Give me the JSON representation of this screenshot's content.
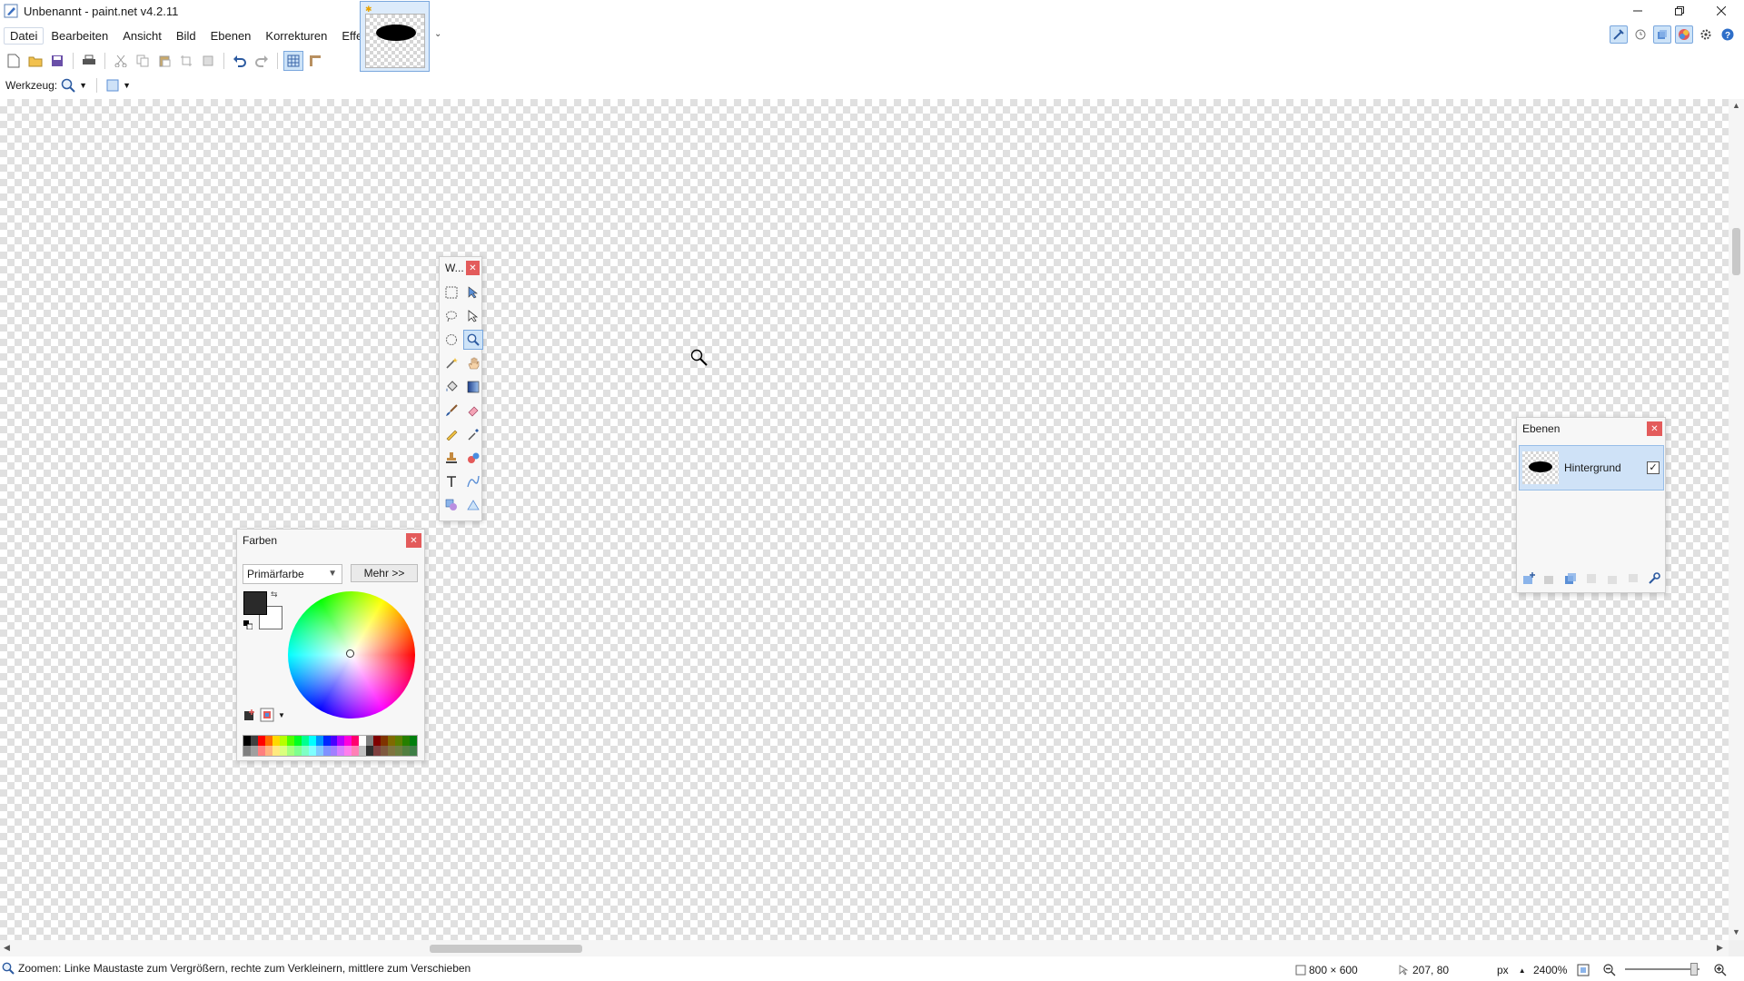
{
  "window": {
    "title": "Unbenannt - paint.net v4.2.11"
  },
  "menu": [
    "Datei",
    "Bearbeiten",
    "Ansicht",
    "Bild",
    "Ebenen",
    "Korrekturen",
    "Effekte"
  ],
  "toolrow": {
    "label": "Werkzeug:"
  },
  "tools_window": {
    "title": "W..."
  },
  "colors_window": {
    "title": "Farben",
    "select_value": "Primärfarbe",
    "more_label": "Mehr >>",
    "primary_color": "#2a2a2a",
    "secondary_color": "#ffffff"
  },
  "layers_window": {
    "title": "Ebenen",
    "layers": [
      {
        "name": "Hintergrund",
        "visible": true
      }
    ]
  },
  "status": {
    "hint": "Zoomen: Linke Maustaste zum Vergrößern, rechte zum Verkleinern, mittlere zum Verschieben",
    "image_size": "800 × 600",
    "cursor_pos": "207, 80",
    "unit": "px",
    "zoom": "2400%"
  },
  "palette": [
    "#000000",
    "#404040",
    "#ff0000",
    "#ff6a00",
    "#ffd800",
    "#b6ff00",
    "#4cff00",
    "#00ff21",
    "#00ff90",
    "#00ffff",
    "#0094ff",
    "#0026ff",
    "#4800ff",
    "#b200ff",
    "#ff00dc",
    "#ff006e",
    "#ffffff",
    "#808080",
    "#7f0000",
    "#7f3300",
    "#7f6a00",
    "#5b7f00",
    "#267f00",
    "#007f0e"
  ],
  "palette2": [
    "#808080",
    "#a0a0a0",
    "#ff7f7f",
    "#ffb27f",
    "#ffe97f",
    "#daff7f",
    "#a5ff7f",
    "#7fff8e",
    "#7fffc5",
    "#7fffff",
    "#7fc9ff",
    "#7f92ff",
    "#a17fff",
    "#d67fff",
    "#ff7fed",
    "#ff7fb6",
    "#c0c0c0",
    "#303030",
    "#7f3f3f",
    "#7f593f",
    "#7f743f",
    "#6d7f3f",
    "#527f3f",
    "#3f7f47"
  ]
}
